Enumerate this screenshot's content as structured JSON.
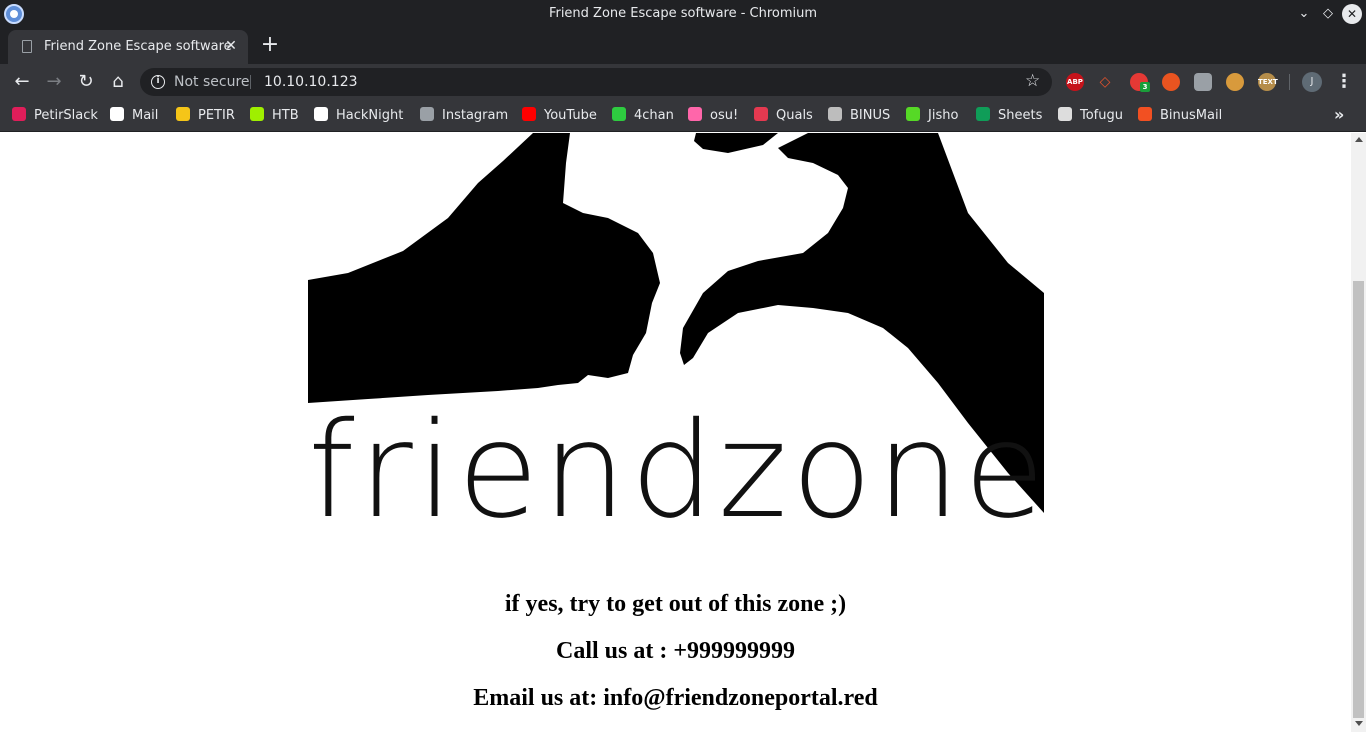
{
  "window": {
    "title": "Friend Zone Escape software - Chromium"
  },
  "tab": {
    "title": "Friend Zone Escape software",
    "close_glyph": "✕",
    "new_tab_glyph": "+"
  },
  "toolbar": {
    "security_label": "Not secure",
    "url": "10.10.10.123",
    "profile_initial": "J",
    "extensions": [
      "ABP",
      "brave",
      "3",
      "ubuntu",
      "line",
      "cookie",
      "TEXT"
    ]
  },
  "bookmarks": [
    {
      "label": "PetirSlack",
      "icon": "slack-icon",
      "color": "#e01e5a"
    },
    {
      "label": "Mail",
      "icon": "mail-icon",
      "color": "#ffffff"
    },
    {
      "label": "PETIR",
      "icon": "lightning-icon",
      "color": "#f5c518"
    },
    {
      "label": "HTB",
      "icon": "cube-icon",
      "color": "#9fef00"
    },
    {
      "label": "HackNight",
      "icon": "github-icon",
      "color": "#ffffff"
    },
    {
      "label": "Instagram",
      "icon": "page-icon",
      "color": "#9aa0a6"
    },
    {
      "label": "YouTube",
      "icon": "youtube-icon",
      "color": "#ff0000"
    },
    {
      "label": "4chan",
      "icon": "clover-icon",
      "color": "#2ecc40"
    },
    {
      "label": "osu!",
      "icon": "osu-icon",
      "color": "#ff66aa"
    },
    {
      "label": "Quals",
      "icon": "quals-icon",
      "color": "#e53950"
    },
    {
      "label": "BINUS",
      "icon": "binus-icon",
      "color": "#bdbdbd"
    },
    {
      "label": "Jisho",
      "icon": "jisho-icon",
      "color": "#56d926"
    },
    {
      "label": "Sheets",
      "icon": "sheets-icon",
      "color": "#0f9d58"
    },
    {
      "label": "Tofugu",
      "icon": "tofugu-icon",
      "color": "#dddddd"
    },
    {
      "label": "BinusMail",
      "icon": "microsoft-icon",
      "color": "#f25022"
    }
  ],
  "page": {
    "logo_text": "friendzone",
    "line1": "if yes, try to get out of this zone ;)",
    "line2": "Call us at : +999999999",
    "line3": "Email us at: info@friendzoneportal.red"
  }
}
